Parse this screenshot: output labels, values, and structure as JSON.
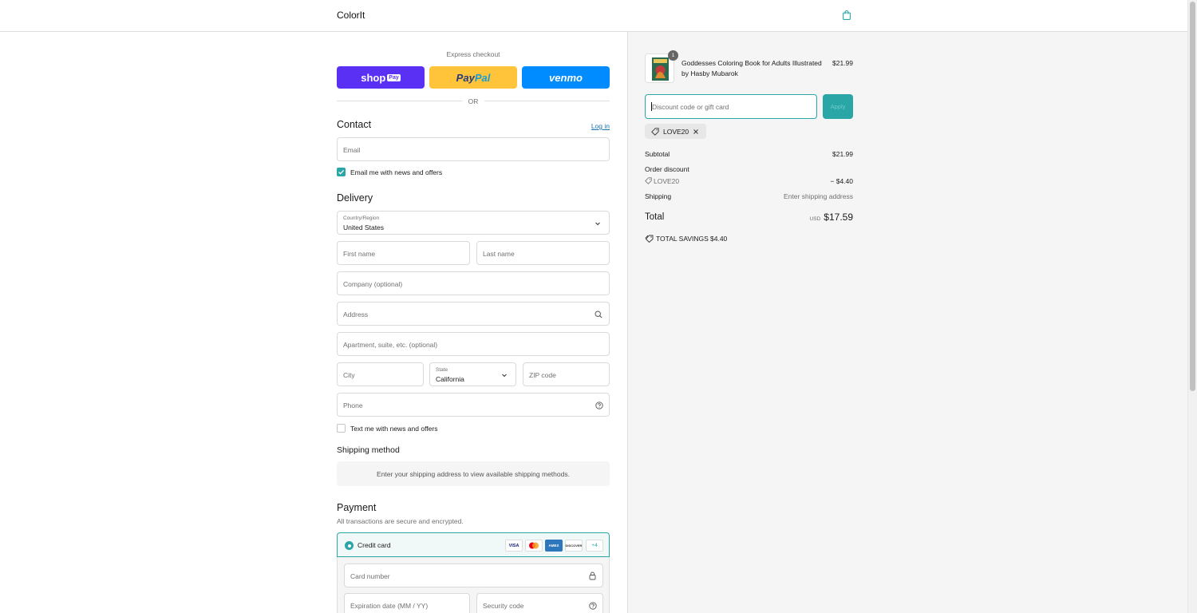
{
  "header": {
    "brand": "ColorIt",
    "cart_icon": "shopping-bag-icon"
  },
  "express": {
    "label": "Express checkout",
    "shop_pay": {
      "shop": "shop",
      "pay": "Pay"
    },
    "paypal": {
      "pay": "Pay",
      "pal": "Pal"
    },
    "venmo": "venmo",
    "or": "OR"
  },
  "contact": {
    "title": "Contact",
    "login": "Log in",
    "email_placeholder": "Email",
    "news_label": "Email me with news and offers",
    "news_checked": true
  },
  "delivery": {
    "title": "Delivery",
    "country_label": "Country/Region",
    "country_value": "United States",
    "first_name": "First name",
    "last_name": "Last name",
    "company": "Company (optional)",
    "address": "Address",
    "apartment": "Apartment, suite, etc. (optional)",
    "city": "City",
    "state_label": "State",
    "state_value": "California",
    "zip": "ZIP code",
    "phone": "Phone",
    "text_label": "Text me with news and offers",
    "text_checked": false
  },
  "shipping": {
    "title": "Shipping method",
    "message": "Enter your shipping address to view available shipping methods."
  },
  "payment": {
    "title": "Payment",
    "subtitle": "All transactions are secure and encrypted.",
    "method": "Credit card",
    "cards": [
      "VISA",
      "MC",
      "AMEX",
      "DISCOVER"
    ],
    "more": "+4",
    "card_number": "Card number",
    "expiry": "Expiration date (MM / YY)",
    "security": "Security code"
  },
  "summary": {
    "product": {
      "name": "Goddesses Coloring Book for Adults Illustrated by Hasby Mubarok",
      "price": "$21.99",
      "quantity": "1"
    },
    "discount_placeholder": "Discount code or gift card",
    "apply": "Apply",
    "applied_code": "LOVE20",
    "subtotal_label": "Subtotal",
    "subtotal": "$21.99",
    "order_discount_label": "Order discount",
    "discount_code": "LOVE20",
    "discount_amount": "− $4.40",
    "shipping_label": "Shipping",
    "shipping_value": "Enter shipping address",
    "total_label": "Total",
    "currency": "USD",
    "total": "$17.59",
    "savings_label": "TOTAL SAVINGS",
    "savings": "$4.40"
  },
  "colors": {
    "accent": "#2aa6a6",
    "shop_pay": "#5a31f4",
    "paypal": "#ffc439",
    "venmo": "#008cff",
    "link": "#1773b0"
  }
}
